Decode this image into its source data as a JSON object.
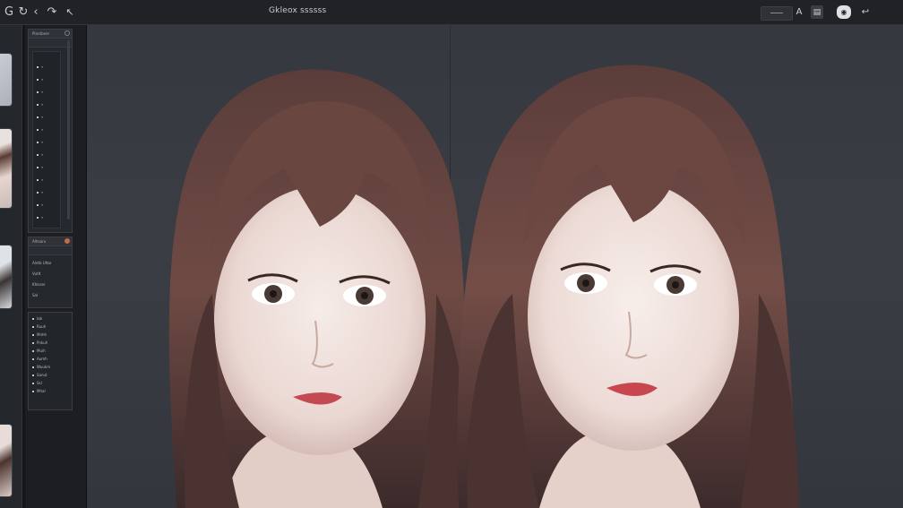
{
  "window": {
    "title": "Gkleox ssssss",
    "accent": "#2c2f35"
  },
  "toolbar": {
    "icons": [
      "back-circle-icon",
      "refresh-icon",
      "chevron-left-icon",
      "redo-icon",
      "cursor-icon"
    ],
    "glyphs": [
      "G",
      "↻",
      "‹",
      "↷",
      "↖"
    ],
    "right_icons": [
      "text-icon",
      "document-icon",
      "eye-icon",
      "back-arrow-icon"
    ],
    "right_glyphs": [
      "A",
      "▤",
      "◉",
      "↩"
    ]
  },
  "panels": {
    "layers_header": "Plantbeer",
    "layer_rows": [
      "»",
      "»",
      "»",
      "»",
      "»",
      "»",
      "»",
      "»",
      "»",
      "»",
      "»",
      "»",
      "»"
    ],
    "props_header": "Alhoaru",
    "props_rows": [
      "Alntb Ultar",
      "Vutlt",
      "Khlsser",
      "Sal"
    ],
    "tree_rows": [
      "lob",
      "Ruuh",
      "Mnhh",
      "Pnkuh",
      "Muih",
      "Aumh",
      "Wuukm",
      "Sanut",
      "Ssl",
      "Mhal"
    ]
  },
  "canvas": {
    "background": "#383a41",
    "images": [
      "before-portrait",
      "after-portrait"
    ]
  }
}
